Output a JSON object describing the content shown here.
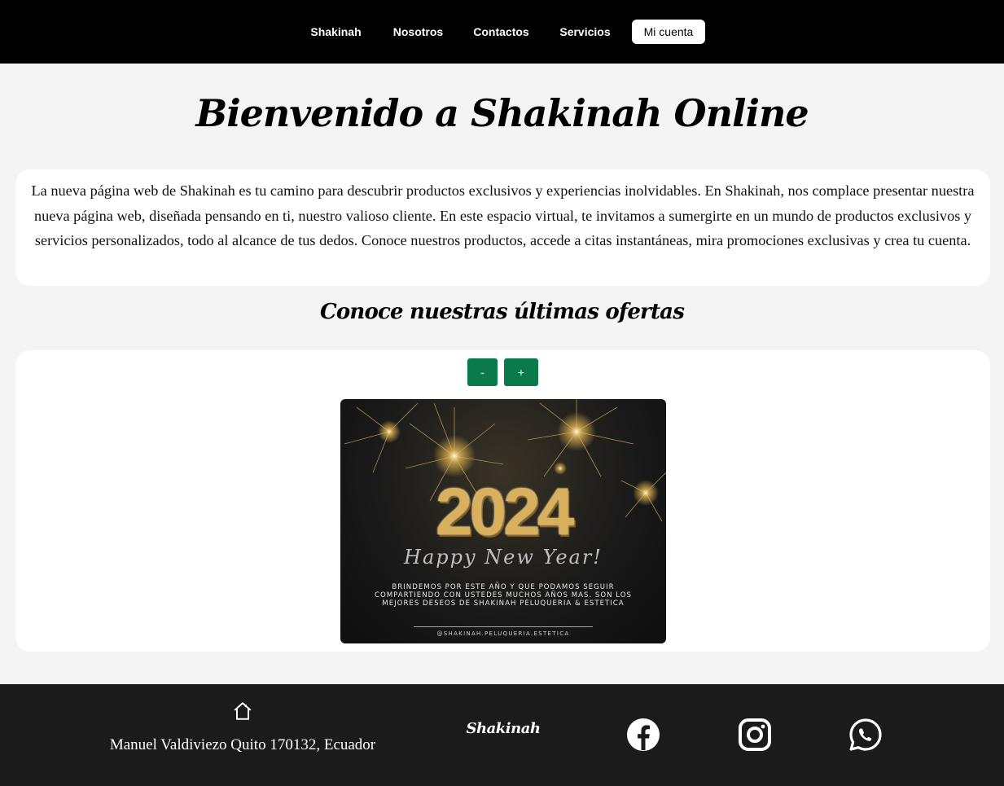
{
  "nav": {
    "items": [
      {
        "label": "Shakinah"
      },
      {
        "label": "Nosotros"
      },
      {
        "label": "Contactos"
      },
      {
        "label": "Servicios"
      },
      {
        "label": "Mi cuenta"
      }
    ]
  },
  "main": {
    "title": "Bienvenido a Shakinah Online",
    "intro": "La nueva página web de Shakinah es tu camino para descubrir productos exclusivos y experiencias inolvidables. En Shakinah, nos complace presentar nuestra nueva página web, diseñada pensando en ti, nuestro valioso cliente. En este espacio virtual, te invitamos a sumergirte en un mundo de productos exclusivos y servicios personalizados, todo al alcance de tus dedos. Conoce nuestros productos, accede a citas instantáneas, mira promociones exclusivas y crea tu cuenta.",
    "offers_title": "Conoce nuestras últimas ofertas"
  },
  "carousel": {
    "prev_label": "-",
    "next_label": "+",
    "slide": {
      "year": "2024",
      "script": "Happy New Year!",
      "message": "BRINDEMOS POR ESTE AÑO Y QUE PODAMOS SEGUIR COMPARTIENDO CON USTEDES MUCHOS AÑOS MAS. SON LOS MEJORES DESEOS DE SHAKINAH PELUQUERIA & ESTETICA",
      "handle": "@SHAKINAH.PELUQUERIA.ESTETICA"
    }
  },
  "footer": {
    "address": "Manuel Valdiviezo Quito 170132, Ecuador",
    "brand": "Shakinah",
    "icons": [
      "home-icon",
      "facebook-icon",
      "instagram-icon",
      "whatsapp-icon"
    ]
  },
  "colors": {
    "nav_bg": "#000000",
    "page_bg": "#f4f4f4",
    "button_green": "#0b7a4b",
    "footer_bg": "#1b1b1b",
    "gold": "#d9b15e"
  }
}
